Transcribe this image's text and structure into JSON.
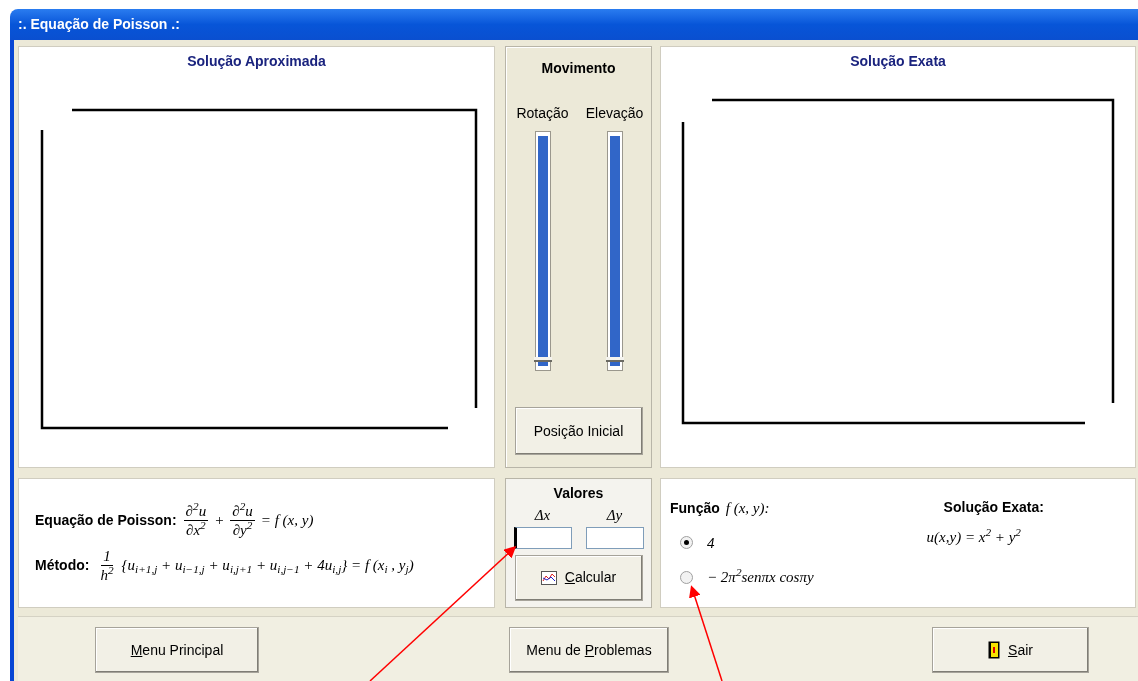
{
  "window": {
    "title": ":. Equação de Poisson .:"
  },
  "approx_panel": {
    "title": "Solução Aproximada"
  },
  "movement": {
    "title": "Movimento",
    "sliders": [
      {
        "label": "Rotação",
        "level": 0
      },
      {
        "label": "Elevação",
        "level": 0
      }
    ],
    "reset_button": "Posição Inicial"
  },
  "exact_panel": {
    "title": "Solução Exata"
  },
  "equation": {
    "label": "Equação de Poisson:",
    "terms": [
      {
        "kind": "fraction",
        "num": "∂$^{2}$u",
        "den": "∂x$^{2}$"
      },
      {
        "kind": "text",
        "text": "+"
      },
      {
        "kind": "fraction",
        "num": "∂$^{2}$u",
        "den": "∂y$^{2}$"
      },
      {
        "kind": "text",
        "text": "= f (x, y)"
      }
    ]
  },
  "method": {
    "label": "Método:",
    "terms": [
      {
        "kind": "fraction",
        "num": "1",
        "den": "h$^{2}$"
      },
      {
        "kind": "text",
        "text": "{u$_{i+1,j}$ + u$_{i−1,j}$ + u$_{i,j+1}$ + u$_{i,j−1}$ + 4u$_{i,j}$} = f (x$_{i}$ , y$_{j}$)"
      }
    ]
  },
  "values": {
    "title": "Valores",
    "fields": [
      {
        "label": "Δx",
        "focused": true
      },
      {
        "label": "Δy",
        "focused": false
      }
    ],
    "calc_button": {
      "key": "C",
      "after": "alcular"
    }
  },
  "function": {
    "label": "Função",
    "formula": "f (x, y):",
    "options": [
      {
        "text": "4",
        "selected": true
      },
      {
        "text": "− 2π$^{2}$senπx cosπy",
        "selected": false
      }
    ],
    "exact_title": "Solução Exata:",
    "exact_formula": "u(x,y) = x$^{2}$ + y$^{2}$"
  },
  "buttons": [
    {
      "kind": "plain",
      "key": "M",
      "after": "enu Principal"
    },
    {
      "kind": "plain",
      "before": "Menu de ",
      "key": "P",
      "after": "roblemas"
    },
    {
      "kind": "exit",
      "key": "S",
      "after": "air"
    }
  ]
}
